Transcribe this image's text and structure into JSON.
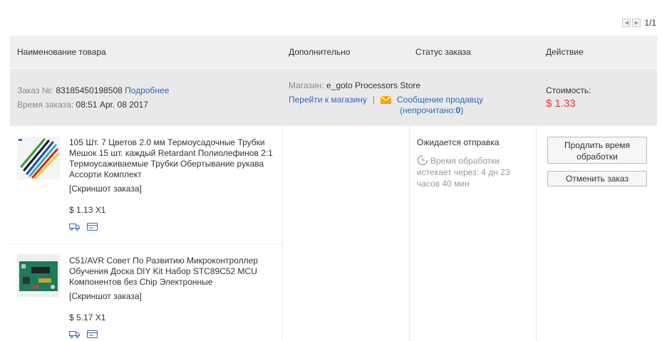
{
  "pager": {
    "text": "1/1"
  },
  "header": {
    "product": "Наименование товара",
    "extra": "Дополнительно",
    "status": "Статус заказа",
    "action": "Действие"
  },
  "order": {
    "number_label": "Заказ №:",
    "number": "83185450198508",
    "details_link": "Подробнее",
    "time_label": "Время заказа:",
    "time": "08:51 Apr. 08 2017",
    "store_label": "Магазин:",
    "store_name": "e_goto Processors Store",
    "go_to_store": "Перейти к магазину",
    "separator": "|",
    "message_seller": "Сообщение продавцу",
    "unread_label": "(непрочитано:",
    "unread_count": "0",
    "unread_close": ")",
    "cost_label": "Стоимость:",
    "cost": "$ 1.33"
  },
  "status": {
    "text": "Ожидается отправка",
    "processing_line1": "Время обработки",
    "processing_line2": "истекает через: 4 дн 23",
    "processing_line3": "часов 40 мин"
  },
  "actions": {
    "extend_line1": "Продлить время",
    "extend_line2": "обработки",
    "cancel": "Отменить заказ"
  },
  "items": [
    {
      "name": "105 Шт. 7 Цветов 2.0 мм Термоусадочные Трубки Мешок 15 шт. каждый Retardant Полиолефинов 2:1 Термоусаживаемые Трубки Обертывание рукава Ассорти Комплект",
      "snapshot": "[Скриншот заказа]",
      "price": "$ 1.13 X1"
    },
    {
      "name": "C51/AVR Совет По Развитию Микроконтроллер Обучения Доска DIY Kit Набор STC89C52 MCU Компонентов без Chip Электронные",
      "snapshot": "[Скриншот заказа]",
      "price": "$ 5.17 X1"
    }
  ],
  "colors": {
    "link": "#3366bb",
    "price_red": "#e4393c",
    "header_bg": "#efefef",
    "order_bg": "#e9e9e9"
  },
  "icons": [
    "chevron-left-icon",
    "chevron-right-icon",
    "envelope-icon",
    "clock-icon",
    "truck-icon",
    "card-icon"
  ]
}
